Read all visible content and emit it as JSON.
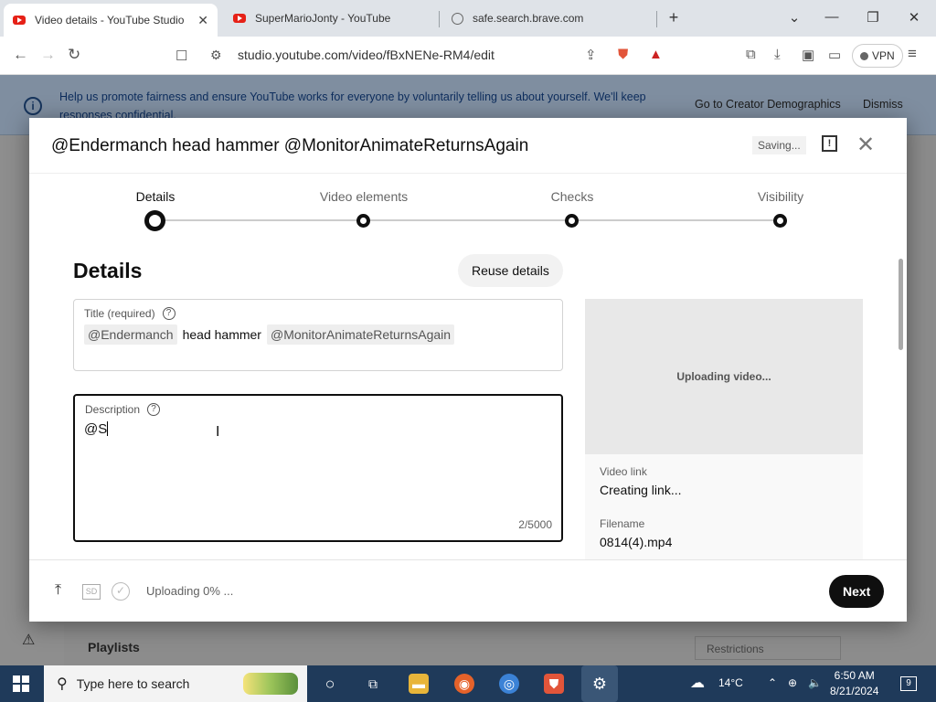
{
  "browser": {
    "tabs": [
      {
        "title": "Video details - YouTube Studio",
        "active": true
      },
      {
        "title": "SuperMarioJonty - YouTube",
        "active": false
      },
      {
        "title": "safe.search.brave.com",
        "active": false
      }
    ],
    "url": "studio.youtube.com/video/fBxNENe-RM4/edit",
    "vpn_label": "VPN"
  },
  "banner": {
    "text": "Help us promote fairness and ensure YouTube works for everyone by voluntarily telling us about yourself. We'll keep responses confidential.",
    "primary_action": "Go to Creator Demographics",
    "dismiss": "Dismiss"
  },
  "background_page": {
    "playlists_heading": "Playlists",
    "restrictions_label": "Restrictions"
  },
  "modal": {
    "title": "@Endermanch head hammer @MonitorAnimateReturnsAgain",
    "saving_status": "Saving...",
    "steps": [
      {
        "label": "Details",
        "active": true
      },
      {
        "label": "Video elements",
        "active": false
      },
      {
        "label": "Checks",
        "active": false
      },
      {
        "label": "Visibility",
        "active": false
      }
    ],
    "section_heading": "Details",
    "reuse_button": "Reuse details",
    "title_field": {
      "label": "Title (required)",
      "mention_1": "@Endermanch",
      "plain_text": "head hammer",
      "mention_2": "@MonitorAnimateReturnsAgain"
    },
    "description_field": {
      "label": "Description",
      "value": "@S",
      "counter": "2/5000"
    },
    "preview": {
      "status": "Uploading video...",
      "video_link_label": "Video link",
      "video_link_value": "Creating link...",
      "filename_label": "Filename",
      "filename_value": "0814(4).mp4"
    },
    "footer": {
      "sd_badge": "SD",
      "upload_status": "Uploading 0% ...",
      "next_button": "Next"
    }
  },
  "taskbar": {
    "search_placeholder": "Type here to search",
    "weather": "14°C",
    "time": "6:50 AM",
    "date": "8/21/2024",
    "notification_count": "9"
  },
  "icons": [
    "youtube-icon",
    "globe-icon",
    "back-icon",
    "forward-icon",
    "reload-icon",
    "bookmark-icon",
    "site-info-icon",
    "share-icon",
    "brave-shield-icon",
    "brave-rewards-icon",
    "extensions-icon",
    "download-icon",
    "sidebar-icon",
    "wallet-icon",
    "menu-icon",
    "info-icon",
    "feedback-icon",
    "close-icon",
    "help-icon",
    "upload-icon",
    "check-circle-icon",
    "windows-start-icon",
    "search-icon"
  ]
}
